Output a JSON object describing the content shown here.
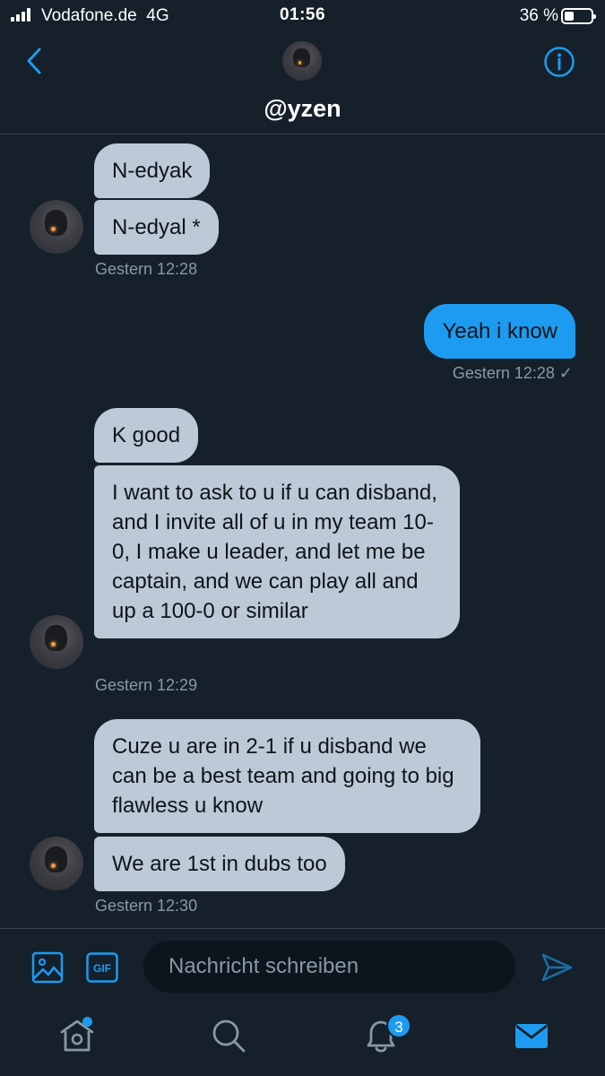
{
  "status_bar": {
    "carrier": "Vodafone.de",
    "network": "4G",
    "time": "01:56",
    "battery_percent": "36 %"
  },
  "header": {
    "title": "@yzen"
  },
  "messages": [
    {
      "text": "N-edyak",
      "direction": "incoming"
    },
    {
      "text": "N-edyal *",
      "direction": "incoming"
    },
    {
      "text": "Yeah i know",
      "direction": "outgoing"
    },
    {
      "text": "K good",
      "direction": "incoming"
    },
    {
      "text": "I want to ask to u if u can disband, and I invite all of u in my team 10-0, I make u leader, and let me be captain, and we can play all and up a 100-0 or similar",
      "direction": "incoming"
    },
    {
      "text": "Cuze u are in 2-1 if u disband we can be a best team and going to big flawless u know",
      "direction": "incoming"
    },
    {
      "text": "We are 1st in dubs too",
      "direction": "incoming"
    }
  ],
  "timestamps": [
    "Gestern 12:28",
    "Gestern 12:28 ✓",
    "Gestern 12:29",
    "Gestern 12:30"
  ],
  "composer": {
    "placeholder": "Nachricht schreiben",
    "gif_label": "GIF"
  },
  "tabbar": {
    "notifications_badge": "3"
  },
  "colors": {
    "background": "#15202b",
    "incoming_bubble": "#bbcad6",
    "outgoing_bubble": "#1d9bf0",
    "accent": "#1d9bf0",
    "muted_text": "#8899a6"
  }
}
